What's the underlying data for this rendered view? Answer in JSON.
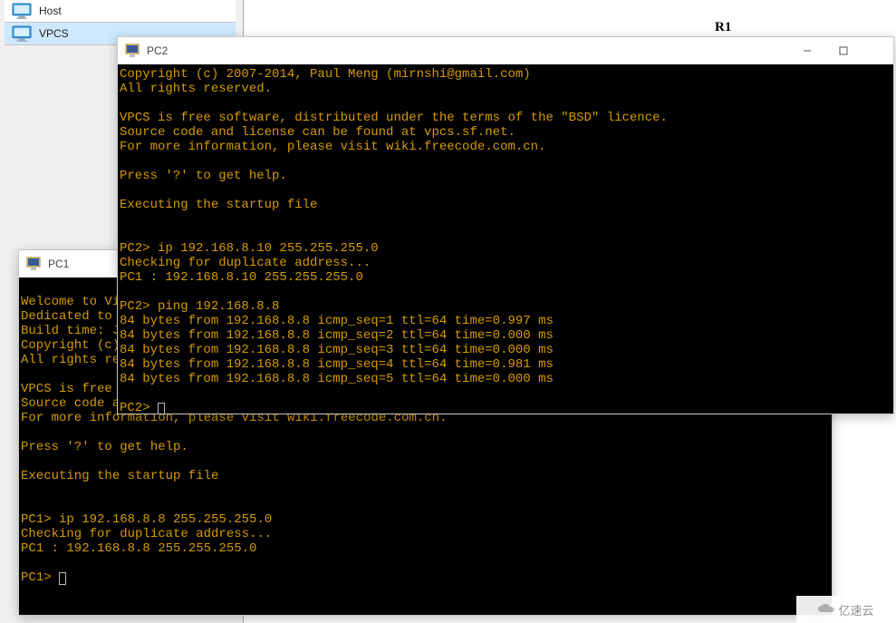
{
  "sidebar": {
    "items": [
      {
        "label": "Host"
      },
      {
        "label": "VPCS"
      }
    ]
  },
  "canvas": {
    "r1_label": "R1"
  },
  "pc1": {
    "title": "PC1",
    "lines": {
      "l0": "",
      "l1": "Welcome to Vi",
      "l2": "Dedicated to ",
      "l3": "Build time: J",
      "l4": "Copyright (c)",
      "l5": "All rights res",
      "l6": "",
      "l7": "VPCS is free s",
      "l8": "Source code an",
      "l9": "For more information, please visit wiki.freecode.com.cn.",
      "l10": "",
      "l11": "Press '?' to get help.",
      "l12": "",
      "l13": "Executing the startup file",
      "l14": "",
      "l15": "",
      "l16": "PC1> ip 192.168.8.8 255.255.255.0",
      "l17": "Checking for duplicate address...",
      "l18": "PC1 : 192.168.8.8 255.255.255.0",
      "l19": "",
      "l20": "PC1> "
    }
  },
  "pc2": {
    "title": "PC2",
    "lines": {
      "l0": "Copyright (c) 2007-2014, Paul Meng (mirnshi@gmail.com)",
      "l1": "All rights reserved.",
      "l2": "",
      "l3": "VPCS is free software, distributed under the terms of the \"BSD\" licence.",
      "l4": "Source code and license can be found at vpcs.sf.net.",
      "l5": "For more information, please visit wiki.freecode.com.cn.",
      "l6": "",
      "l7": "Press '?' to get help.",
      "l8": "",
      "l9": "Executing the startup file",
      "l10": "",
      "l11": "",
      "l12": "PC2> ip 192.168.8.10 255.255.255.0",
      "l13": "Checking for duplicate address...",
      "l14": "PC1 : 192.168.8.10 255.255.255.0",
      "l15": "",
      "l16": "PC2> ping 192.168.8.8",
      "l17": "84 bytes from 192.168.8.8 icmp_seq=1 ttl=64 time=0.997 ms",
      "l18": "84 bytes from 192.168.8.8 icmp_seq=2 ttl=64 time=0.000 ms",
      "l19": "84 bytes from 192.168.8.8 icmp_seq=3 ttl=64 time=0.000 ms",
      "l20": "84 bytes from 192.168.8.8 icmp_seq=4 ttl=64 time=0.981 ms",
      "l21": "84 bytes from 192.168.8.8 icmp_seq=5 ttl=64 time=0.000 ms",
      "l22": "",
      "l23": "PC2> "
    }
  },
  "watermark": {
    "text": "亿速云"
  }
}
